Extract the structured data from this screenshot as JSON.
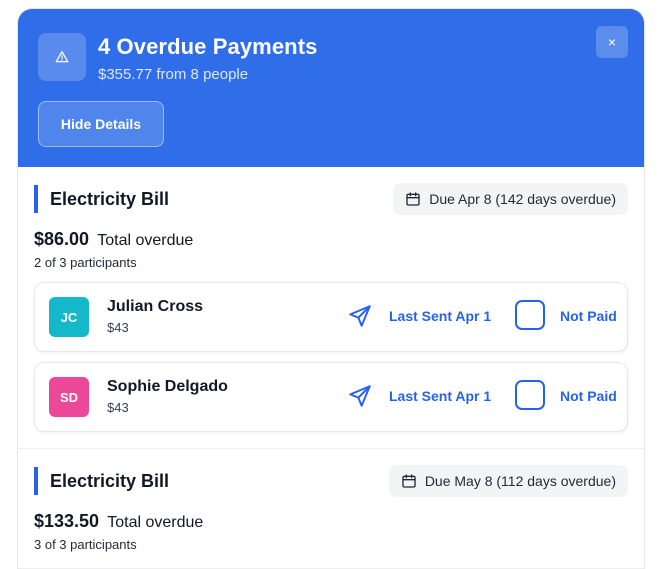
{
  "header": {
    "title": "4 Overdue Payments",
    "subtitle": "$355.77 from 8 people",
    "hide_details_label": "Hide Details",
    "close_label": "×",
    "accent_color": "#2f6ee8"
  },
  "bills": [
    {
      "name": "Electricity Bill",
      "due_text": "Due Apr 8 (142 days overdue)",
      "amount": "$86.00",
      "amount_suffix": "Total overdue",
      "participants_text": "2 of 3 participants",
      "participants": [
        {
          "initials": "JC",
          "name": "Julian Cross",
          "amount": "$43",
          "avatar_color": "#14b8c9",
          "last_sent": "Last Sent Apr 1",
          "status": "Not Paid"
        },
        {
          "initials": "SD",
          "name": "Sophie Delgado",
          "amount": "$43",
          "avatar_color": "#ec4899",
          "last_sent": "Last Sent Apr 1",
          "status": "Not Paid"
        }
      ]
    },
    {
      "name": "Electricity Bill",
      "due_text": "Due May 8 (112 days overdue)",
      "amount": "$133.50",
      "amount_suffix": "Total overdue",
      "participants_text": "3 of 3 participants"
    }
  ]
}
